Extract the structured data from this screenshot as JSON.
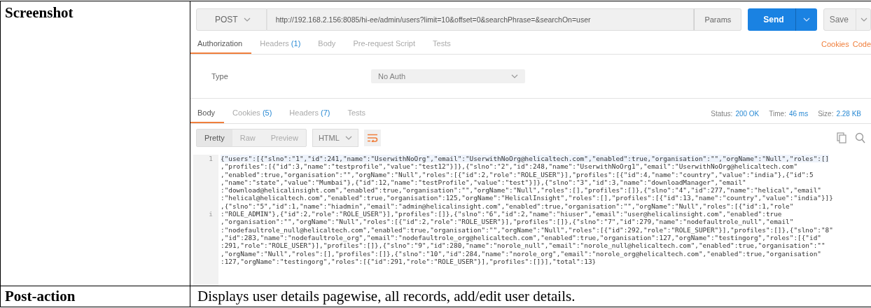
{
  "table": {
    "rows": [
      {
        "heading": "Screenshot",
        "kind": "screenshot"
      },
      {
        "heading": "Post-action",
        "kind": "text",
        "description": "Displays user details pagewise, all records, add/edit user details."
      }
    ]
  },
  "screenshot": {
    "request": {
      "method": "POST",
      "url": "http://192.168.2.156:8085/hi-ee/admin/users?limit=10&offset=0&searchPhrase=&searchOn=user",
      "params_button": "Params",
      "send_button": "Send",
      "save_button": "Save"
    },
    "request_tabs": [
      {
        "label": "Authorization",
        "selected": true
      },
      {
        "label": "Headers",
        "count": "(1)",
        "selected": false
      },
      {
        "label": "Body",
        "selected": false
      },
      {
        "label": "Pre-request Script",
        "selected": false
      },
      {
        "label": "Tests",
        "selected": false
      }
    ],
    "request_links": [
      "Cookies",
      "Code"
    ],
    "authorization": {
      "label": "Type",
      "value": "No Auth"
    },
    "response_tabs": [
      {
        "label": "Body",
        "selected": true
      },
      {
        "label": "Cookies",
        "count": "(5)",
        "selected": false
      },
      {
        "label": "Headers",
        "count": "(7)",
        "selected": false
      },
      {
        "label": "Tests",
        "selected": false
      }
    ],
    "response_stats": [
      {
        "label": "Status:",
        "value": "200 OK"
      },
      {
        "label": "Time:",
        "value": "46 ms"
      },
      {
        "label": "Size:",
        "value": "2.28 KB"
      }
    ],
    "view_modes": [
      {
        "label": "Pretty",
        "selected": true
      },
      {
        "label": "Raw",
        "selected": false
      },
      {
        "label": "Preview",
        "selected": false
      }
    ],
    "format": "HTML",
    "code_lines": [
      {
        "gutter": "1",
        "text": "{\"users\":[{\"slno\":\"1\",\"id\":241,\"name\":\"UserwithNoOrg\",\"email\":\"UserwithNoOrg@helicaltech.com\",\"enabled\":true,\"organisation\":\"\",\"orgName\":\"Null\",\"roles\":[]"
      },
      {
        "text": ",\"profiles\":[{\"id\":3,\"name\":\"testprofile\",\"value\":\"test12\"}]},{\"slno\":\"2\",\"id\":248,\"name\":\"UserwithNoOrg1\",\"email\":\"UserwithNoOrg@helicaltech.com\""
      },
      {
        "text": ",\"enabled\":true,\"organisation\":\"\",\"orgName\":\"Null\",\"roles\":[{\"id\":2,\"role\":\"ROLE_USER\"}],\"profiles\":[{\"id\":4,\"name\":\"country\",\"value\":\"india\"},{\"id\":5"
      },
      {
        "text": ",\"name\":\"state\",\"value\":\"Mumbai\"},{\"id\":12,\"name\":\"testProfile\",\"value\":\"test\"}]},{\"slno\":\"3\",\"id\":3,\"name\":\"downloadManager\",\"email\""
      },
      {
        "text": ":\"download@helicalinsight.com\",\"enabled\":true,\"organisation\":\"\",\"orgName\":\"Null\",\"roles\":[],\"profiles\":[]},{\"slno\":\"4\",\"id\":277,\"name\":\"helical\",\"email\""
      },
      {
        "text": ":\"helical@helicaltech.com\",\"enabled\":true,\"organisation\":125,\"orgName\":\"HelicalInsight\",\"roles\":[],\"profiles\":[{\"id\":13,\"name\":\"country\",\"value\":\"india\"}]}"
      },
      {
        "text": ",{\"slno\":\"5\",\"id\":1,\"name\":\"hiadmin\",\"email\":\"admin@helicalinsight.com\",\"enabled\":true,\"organisation\":\"\",\"orgName\":\"Null\",\"roles\":[{\"id\":1,\"role\""
      },
      {
        "gutter": "i",
        "text": ":\"ROLE_ADMIN\"},{\"id\":2,\"role\":\"ROLE_USER\"}],\"profiles\":[]},{\"slno\":\"6\",\"id\":2,\"name\":\"hiuser\",\"email\":\"user@helicalinsight.com\",\"enabled\":true"
      },
      {
        "text": ",\"organisation\":\"\",\"orgName\":\"Null\",\"roles\":[{\"id\":2,\"role\":\"ROLE_USER\"}],\"profiles\":[]},{\"slno\":\"7\",\"id\":279,\"name\":\"nodefaultrole_null\",\"email\""
      },
      {
        "text": ":\"nodefaultrole_null@helicaltech.com\",\"enabled\":true,\"organisation\":\"\",\"orgName\":\"Null\",\"roles\":[{\"id\":292,\"role\":\"ROLE_SUPER\"}],\"profiles\":[]},{\"slno\":\"8\""
      },
      {
        "text": ",\"id\":283,\"name\":\"nodefaultrole_org\",\"email\":\"nodefaultrole_org@helicaltech.com\",\"enabled\":true,\"organisation\":127,\"orgName\":\"testingorg\",\"roles\":[{\"id\""
      },
      {
        "text": ":291,\"role\":\"ROLE_USER\"}],\"profiles\":[]},{\"slno\":\"9\",\"id\":280,\"name\":\"norole_null\",\"email\":\"norole_null@helicaltech.com\",\"enabled\":true,\"organisation\":\"\""
      },
      {
        "text": ",\"orgName\":\"Null\",\"roles\":[],\"profiles\":[]},{\"slno\":\"10\",\"id\":284,\"name\":\"norole_org\",\"email\":\"norole_org@helicaltech.com\",\"enabled\":true,\"organisation\""
      },
      {
        "text": ":127,\"orgName\":\"testingorg\",\"roles\":[{\"id\":291,\"role\":\"ROLE_USER\"}],\"profiles\":[]}],\"total\":13}"
      }
    ]
  }
}
